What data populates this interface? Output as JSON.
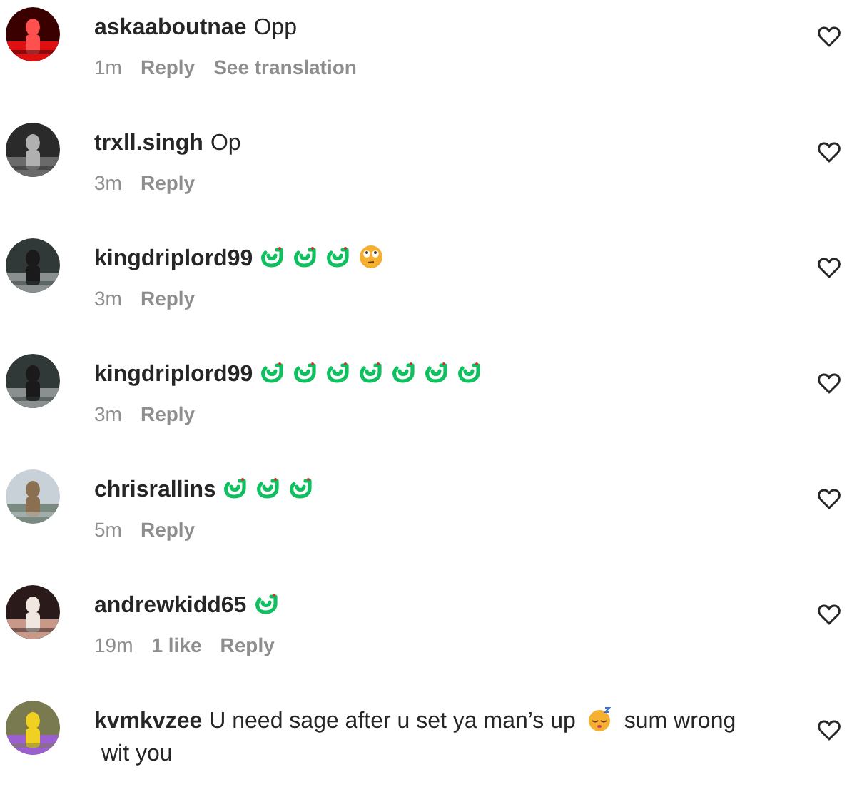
{
  "comments": [
    {
      "username": "askaaboutnae",
      "content": [
        {
          "kind": "text",
          "text": "Opp"
        }
      ],
      "time": "1m",
      "actions": [
        "Reply",
        "See translation"
      ]
    },
    {
      "username": "trxll.singh",
      "content": [
        {
          "kind": "text",
          "text": "Op"
        }
      ],
      "time": "3m",
      "actions": [
        "Reply"
      ]
    },
    {
      "username": "kingdriplord99",
      "content": [
        {
          "kind": "snake"
        },
        {
          "kind": "snake"
        },
        {
          "kind": "snake"
        },
        {
          "kind": "eyeroll"
        }
      ],
      "time": "3m",
      "actions": [
        "Reply"
      ]
    },
    {
      "username": "kingdriplord99",
      "content": [
        {
          "kind": "snake"
        },
        {
          "kind": "snake"
        },
        {
          "kind": "snake"
        },
        {
          "kind": "snake"
        },
        {
          "kind": "snake"
        },
        {
          "kind": "snake"
        },
        {
          "kind": "snake"
        }
      ],
      "time": "3m",
      "actions": [
        "Reply"
      ]
    },
    {
      "username": "chrisrallins",
      "content": [
        {
          "kind": "snake"
        },
        {
          "kind": "snake"
        },
        {
          "kind": "snake"
        }
      ],
      "time": "5m",
      "actions": [
        "Reply"
      ]
    },
    {
      "username": "andrewkidd65",
      "content": [
        {
          "kind": "snake"
        }
      ],
      "time": "19m",
      "likes": "1 like",
      "actions": [
        "Reply"
      ]
    },
    {
      "username": "kvmkvzee",
      "content": [
        {
          "kind": "text",
          "text": "U need sage after u set ya man’s up"
        },
        {
          "kind": "sleepy"
        },
        {
          "kind": "text",
          "text": "sum wrong"
        },
        {
          "kind": "text",
          "text": "wit you"
        }
      ]
    }
  ]
}
